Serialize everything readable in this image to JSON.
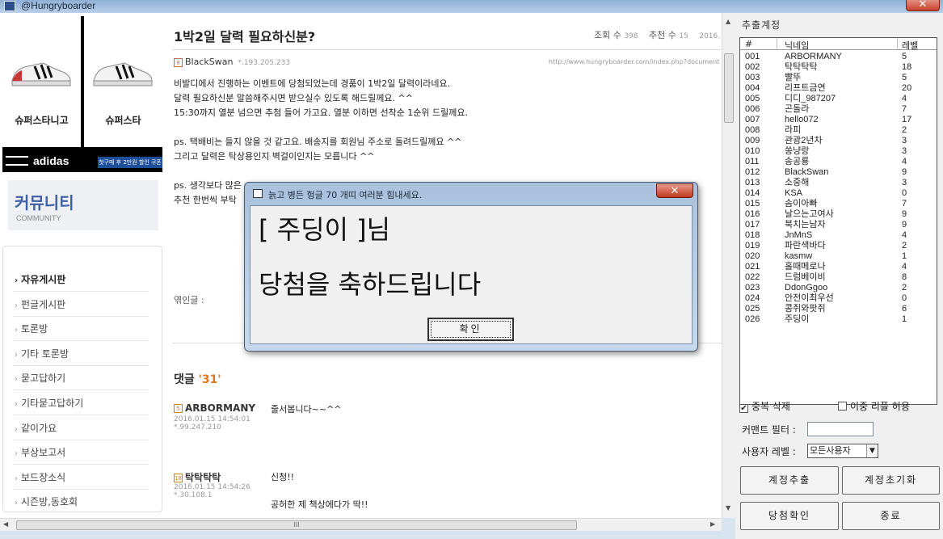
{
  "window": {
    "title": "@Hungryboarder",
    "close_glyph": "✕"
  },
  "sidebar": {
    "ad": {
      "items": [
        "슈퍼스타니고",
        "슈퍼스타"
      ],
      "brand": "adidas",
      "promo": "첫구매 후 2만원 할인 쿠폰"
    },
    "community_title": "커뮤니티",
    "community_sub": "COMMUNITY",
    "menu": [
      "자유게시판",
      "펀글게시판",
      "토론방",
      "기타 토론방",
      "묻고답하기",
      "기타묻고답하기",
      "같이가요",
      "부상보고서",
      "보드장소식",
      "시즌방,동호회"
    ],
    "arrow": "›"
  },
  "post": {
    "title": "1박2일 달력 필요하신분?",
    "views_label": "조회 수",
    "views": "398",
    "recommend_label": "추천 수",
    "recommend": "15",
    "date": "2016.",
    "author_level": "8",
    "author": "BlackSwan",
    "author_ip": "*.193.205.233",
    "url": "http://www.hungryboarder.com/index.php?document",
    "lines": [
      "비발디에서 진행하는 이벤트에 당첨되었는데 경품이 1박2일 달력이라네요.",
      "달력 필요하신분 말씀해주시면 받으실수 있도록 해드릴께요. ^^",
      "15:30까지 열분 넘으면 추첨 들어 가고요. 열분 이하면 선착순 1순위 드릴께요.",
      "",
      "ps. 택배비는 들지 않을 것 같고요. 배송지를 회원님 주소로 돌려드릴께요 ^^",
      "그리고 달력은 탁상용인지 벽걸이인지는 모릅니다 ^^",
      "",
      "ps. 생각보다 많은"
    ],
    "line8": "추천 한번씩 부탁",
    "relation_label": "엮인글 :"
  },
  "comments": {
    "label": "댓글",
    "count": "'31'",
    "items": [
      {
        "level": "5",
        "nick": "ARBORMANY",
        "date": "2016.01.15 14:54:01",
        "ip": "*.99.247.210",
        "text": "줄서봅니다~~^^",
        "text2": ""
      },
      {
        "level": "18",
        "nick": "탁탁탁탁",
        "date": "2016.01.15 14:54:26",
        "ip": "*.30.108.1",
        "text": "신청!!",
        "text2": "공허한 제 책상에다가 딱!!"
      }
    ]
  },
  "scroll": {
    "up": "▲",
    "down": "▼",
    "left": "◀",
    "right": "▶",
    "grip": "III"
  },
  "panel": {
    "title": "추출계정",
    "columns": [
      "#",
      "닉네임",
      "레벨"
    ],
    "rows": [
      [
        "001",
        "ARBORMANY",
        "5"
      ],
      [
        "002",
        "탁탁탁탁",
        "18"
      ],
      [
        "003",
        "빨뚜",
        "5"
      ],
      [
        "004",
        "리프트금연",
        "20"
      ],
      [
        "005",
        "디디_987207",
        "4"
      ],
      [
        "006",
        "곤돌라",
        "7"
      ],
      [
        "007",
        "hello072",
        "17"
      ],
      [
        "008",
        "라피",
        "2"
      ],
      [
        "009",
        "관광2년차",
        "3"
      ],
      [
        "010",
        "쏭냥랑",
        "3"
      ],
      [
        "011",
        "송공룡",
        "4"
      ],
      [
        "012",
        "BlackSwan",
        "9"
      ],
      [
        "013",
        "소중해",
        "3"
      ],
      [
        "014",
        "KSA",
        "0"
      ],
      [
        "015",
        "솜이아빠",
        "7"
      ],
      [
        "016",
        "날으는고여사",
        "9"
      ],
      [
        "017",
        "북치는남자",
        "9"
      ],
      [
        "018",
        "JnMnS",
        "4"
      ],
      [
        "019",
        "파란색바다",
        "2"
      ],
      [
        "020",
        "kasmw",
        "1"
      ],
      [
        "021",
        "홀때메로나",
        "4"
      ],
      [
        "022",
        "드럼베이비",
        "8"
      ],
      [
        "023",
        "DdonGgoo",
        "2"
      ],
      [
        "024",
        "안전이최우선",
        "0"
      ],
      [
        "025",
        "콩쥐와팟쥐",
        "6"
      ],
      [
        "026",
        "주딩이",
        "1"
      ]
    ],
    "dup_delete": "중복 삭제",
    "double_reply": "이중 리플 허용",
    "checked": "✔",
    "comment_filter": "커맨트 필터 :",
    "user_level": "사용자 레벨 :",
    "user_level_value": "모든사용자",
    "dd": "▼",
    "btn_extract": "계정추출",
    "btn_reset": "계정초기화",
    "btn_winner": "당첨확인",
    "btn_exit": "종료"
  },
  "dialog": {
    "title": "늙고 병든 헝글 70 개띠 여러분 힘내세요.",
    "close": "✕",
    "msg1": "[ 주딩이 ]님",
    "msg2": "당첨을 축하드립니다",
    "ok": "확인"
  }
}
